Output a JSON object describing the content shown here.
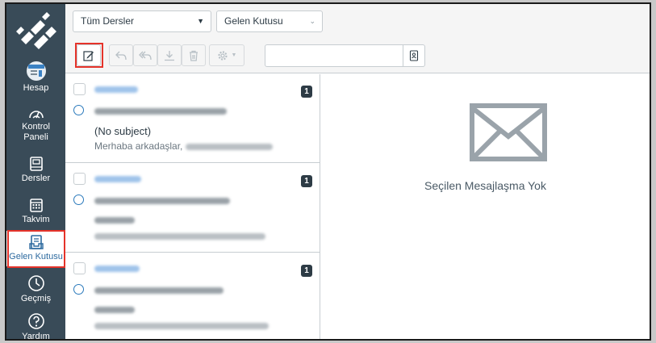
{
  "nav": {
    "items": [
      {
        "label": "Hesap",
        "icon": "account-avatar-icon"
      },
      {
        "label": "Kontrol Paneli",
        "label_line1": "Kontrol",
        "label_line2": "Paneli",
        "icon": "dashboard-icon"
      },
      {
        "label": "Dersler",
        "icon": "courses-icon"
      },
      {
        "label": "Takvim",
        "icon": "calendar-icon"
      },
      {
        "label": "Gelen Kutusu",
        "icon": "inbox-icon",
        "active": true
      },
      {
        "label": "Geçmiş",
        "icon": "history-icon"
      },
      {
        "label": "Yardım",
        "icon": "help-icon"
      }
    ]
  },
  "filters": {
    "course": "Tüm Dersler",
    "mailbox": "Gelen Kutusu"
  },
  "toolbar": {
    "buttons": [
      "compose",
      "reply",
      "reply-all",
      "archive",
      "delete",
      "settings"
    ]
  },
  "messages": [
    {
      "count": "1",
      "subject": "(No subject)",
      "preview": "Merhaba arkadaşlar,"
    },
    {
      "count": "1"
    },
    {
      "count": "1"
    }
  ],
  "detail": {
    "empty_text": "Seçilen Mesajlaşma Yok"
  },
  "colors": {
    "nav_bg": "#394b58",
    "highlight": "#e5332a",
    "link_blue": "#2b7abc"
  }
}
